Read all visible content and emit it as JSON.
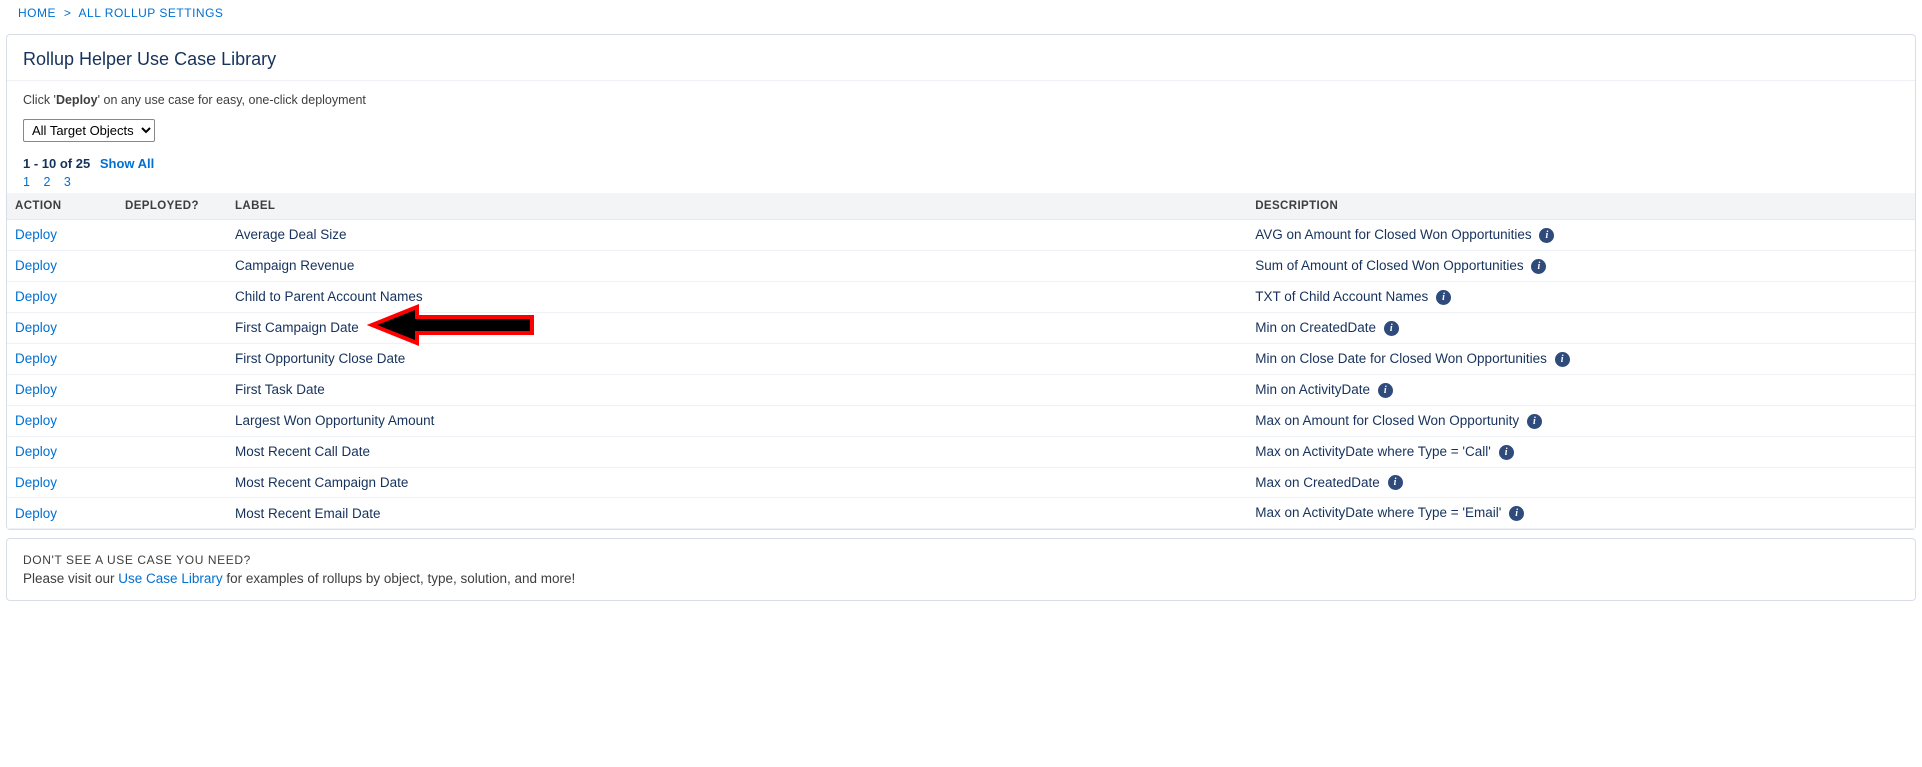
{
  "breadcrumb": {
    "home": "HOME",
    "sep": ">",
    "all": "ALL ROLLUP SETTINGS"
  },
  "page_title": "Rollup Helper Use Case Library",
  "instruction": {
    "pre": "Click '",
    "strong": "Deploy",
    "post": "' on any use case for easy, one-click deployment"
  },
  "target_select": "All Target Objects",
  "pager": {
    "range": "1 - 10 of 25",
    "show_all": "Show All",
    "pages": [
      "1",
      "2",
      "3"
    ]
  },
  "columns": {
    "action": "ACTION",
    "deployed": "DEPLOYED?",
    "label": "LABEL",
    "description": "DESCRIPTION"
  },
  "deploy_label": "Deploy",
  "rows": [
    {
      "label": "Average Deal Size",
      "description": "AVG on Amount for Closed Won Opportunities"
    },
    {
      "label": "Campaign Revenue",
      "description": "Sum of Amount of Closed Won Opportunities"
    },
    {
      "label": "Child to Parent Account Names",
      "description": "TXT of Child Account Names"
    },
    {
      "label": "First Campaign Date",
      "description": "Min on CreatedDate",
      "arrow": true
    },
    {
      "label": "First Opportunity Close Date",
      "description": "Min on Close Date for Closed Won Opportunities"
    },
    {
      "label": "First Task Date",
      "description": "Min on ActivityDate"
    },
    {
      "label": "Largest Won Opportunity Amount",
      "description": "Max on Amount for Closed Won Opportunity"
    },
    {
      "label": "Most Recent Call Date",
      "description": "Max on ActivityDate where Type = 'Call'"
    },
    {
      "label": "Most Recent Campaign Date",
      "description": "Max on CreatedDate"
    },
    {
      "label": "Most Recent Email Date",
      "description": "Max on ActivityDate where Type = 'Email'"
    }
  ],
  "footer": {
    "heading": "DON'T SEE A USE CASE YOU NEED?",
    "pre": "Please visit our ",
    "link": "Use Case Library",
    "post": " for examples of rollups by object, type, solution, and more!"
  }
}
